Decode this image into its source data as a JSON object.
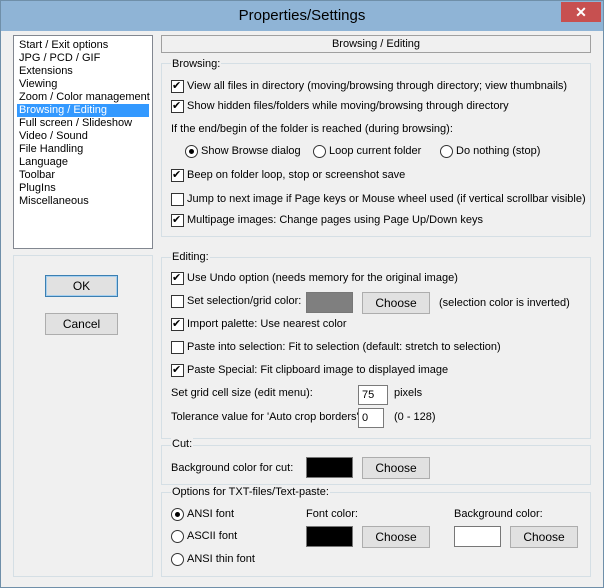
{
  "window": {
    "title": "Properties/Settings",
    "close_glyph": "✕"
  },
  "categories": [
    "Start / Exit options",
    "JPG / PCD / GIF",
    "Extensions",
    "Viewing",
    "Zoom / Color management",
    "Browsing / Editing",
    "Full screen / Slideshow",
    "Video / Sound",
    "File Handling",
    "Language",
    "Toolbar",
    "PlugIns",
    "Miscellaneous"
  ],
  "selected_category": "Browsing / Editing",
  "buttons": {
    "ok": "OK",
    "cancel": "Cancel"
  },
  "page_header": "Browsing / Editing",
  "browsing": {
    "legend": "Browsing:",
    "view_all": {
      "label": "View all files in directory (moving/browsing through directory; view thumbnails)",
      "checked": true
    },
    "show_hidden": {
      "label": "Show hidden files/folders while moving/browsing through directory",
      "checked": true
    },
    "end_begin_label": "If the end/begin of the folder is reached (during browsing):",
    "radio_show_browse": {
      "label": "Show Browse dialog",
      "selected": true
    },
    "radio_loop": {
      "label": "Loop current folder",
      "selected": false
    },
    "radio_nothing": {
      "label": "Do nothing (stop)",
      "selected": false
    },
    "beep": {
      "label": "Beep on folder loop, stop or screenshot save",
      "checked": true
    },
    "jump": {
      "label": "Jump to next image if Page keys or Mouse wheel used (if vertical scrollbar visible)",
      "checked": false
    },
    "multipage": {
      "label": "Multipage images: Change pages using Page Up/Down keys",
      "checked": true
    }
  },
  "editing": {
    "legend": "Editing:",
    "undo": {
      "label": "Use Undo option (needs memory for the original image)",
      "checked": true
    },
    "selection_color": {
      "label": "Set selection/grid color:",
      "checked": false,
      "swatch": "#7f7f7f",
      "choose": "Choose",
      "note": "(selection color is inverted)"
    },
    "import_palette": {
      "label": "Import palette: Use nearest color",
      "checked": true
    },
    "paste_into": {
      "label": "Paste into selection: Fit to selection (default: stretch to selection)",
      "checked": false
    },
    "paste_special": {
      "label": "Paste Special: Fit clipboard image to displayed image",
      "checked": true
    },
    "grid_cell": {
      "label": "Set grid cell size (edit menu):",
      "value": "75",
      "unit": "pixels"
    },
    "tolerance": {
      "label": "Tolerance value for 'Auto crop borders':",
      "value": "0",
      "range": "(0 - 128)"
    }
  },
  "cut": {
    "legend": "Cut:",
    "bg_label": "Background  color for cut:",
    "swatch": "#000000",
    "choose": "Choose"
  },
  "txt": {
    "legend": "Options for TXT-files/Text-paste:",
    "radio_ansi": {
      "label": "ANSI font",
      "selected": true
    },
    "radio_ascii": {
      "label": "ASCII font",
      "selected": false
    },
    "radio_ansi_thin": {
      "label": "ANSI thin font",
      "selected": false
    },
    "font_color_label": "Font color:",
    "font_color_swatch": "#000000",
    "font_choose": "Choose",
    "bg_color_label": "Background color:",
    "bg_color_swatch": "#ffffff",
    "bg_choose": "Choose"
  }
}
